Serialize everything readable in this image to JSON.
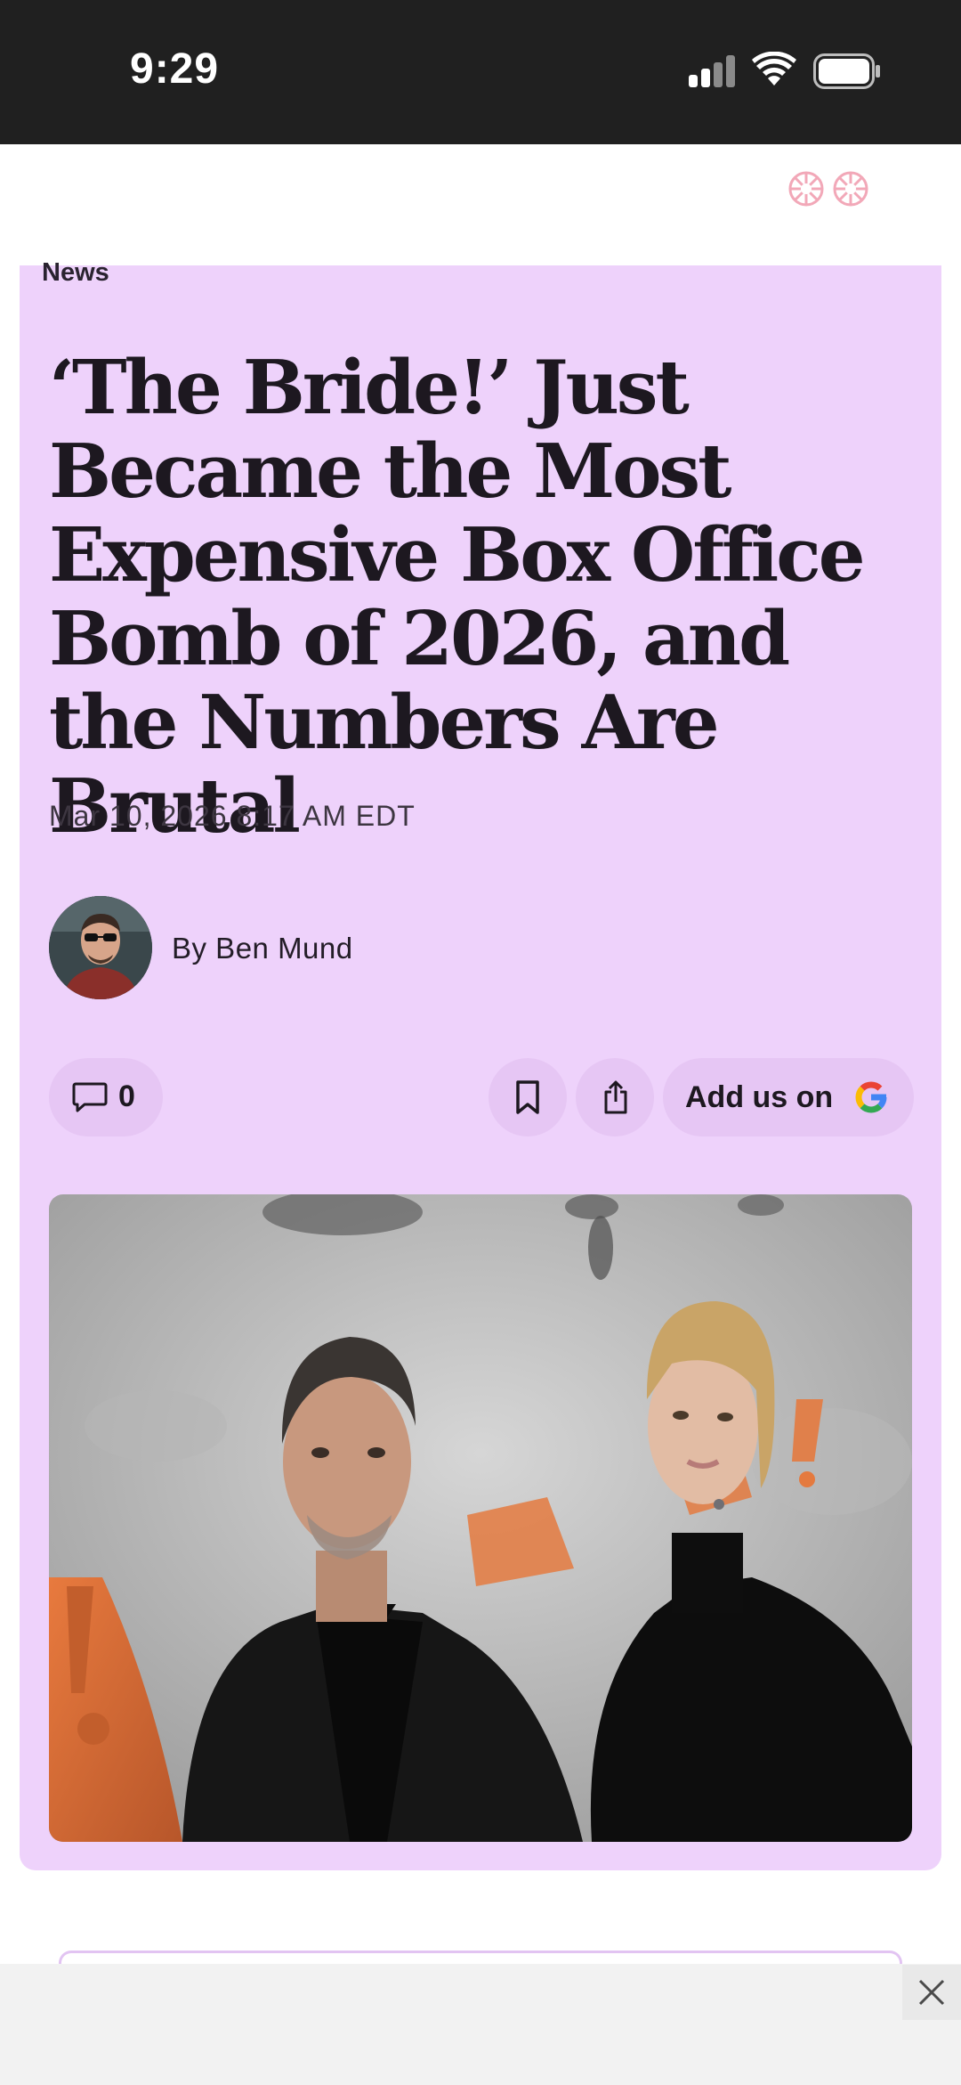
{
  "status_bar": {
    "time": "9:29",
    "icons": [
      "signal-icon",
      "wifi-icon",
      "battery-icon"
    ]
  },
  "header": {
    "icons": [
      "flower-logo-icon",
      "flower-logo-icon"
    ]
  },
  "article": {
    "category": "News",
    "headline": "‘The Bride!’ Just Became the Most Expensive Box Office Bomb of 2026, and the Numbers Are Brutal",
    "date": "Mar 10, 2026 8:17 AM EDT",
    "author": "By Ben Mund",
    "comment_count": "0",
    "add_us_label": "Add us on"
  },
  "colors": {
    "card_background": "#eed2fb",
    "pill_background": "#e6c6f4",
    "status_bar": "#202020",
    "ad_bar": "#f2f2f2"
  },
  "icons": {
    "comment": "comment-icon",
    "bookmark": "bookmark-icon",
    "share": "share-icon",
    "google": "google-icon",
    "close": "close-icon"
  }
}
